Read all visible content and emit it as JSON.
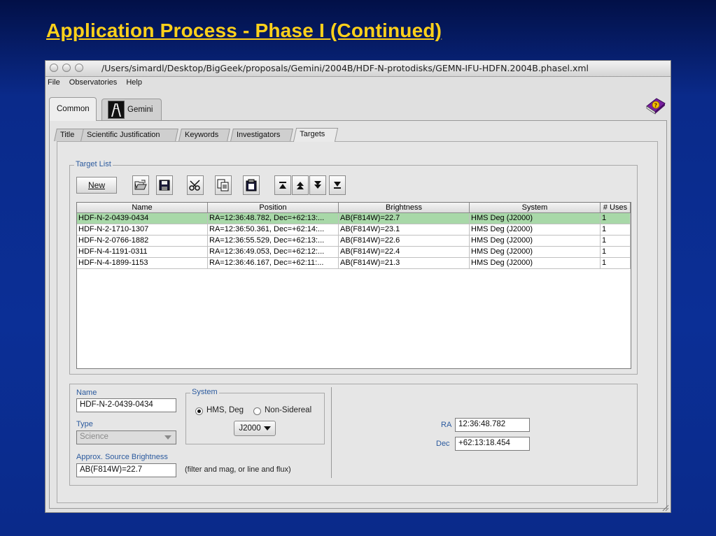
{
  "slide": {
    "title": "Application Process - Phase I (Continued)"
  },
  "window": {
    "path": "/Users/simardl/Desktop/BigGeek/proposals/Gemini/2004B/HDF-N-protodisks/GEMN-IFU-HDFN.2004B.phasel.xml",
    "menu": [
      "File",
      "Observatories",
      "Help"
    ]
  },
  "main_tabs": [
    {
      "label": "Common",
      "active": true
    },
    {
      "label": "Gemini",
      "active": false
    }
  ],
  "sub_tabs": [
    {
      "label": "Title",
      "active": false
    },
    {
      "label": "Scientific Justification",
      "active": false
    },
    {
      "label": "Keywords",
      "active": false
    },
    {
      "label": "Investigators",
      "active": false
    },
    {
      "label": "Targets",
      "active": true
    }
  ],
  "target_list": {
    "legend": "Target List",
    "new_button": "New",
    "columns": [
      "Name",
      "Position",
      "Brightness",
      "System",
      "# Uses"
    ],
    "rows": [
      [
        "HDF-N-2-0439-0434",
        "RA=12:36:48.782, Dec=+62:13:...",
        "AB(F814W)=22.7",
        "HMS Deg (J2000)",
        "1"
      ],
      [
        "HDF-N-2-1710-1307",
        "RA=12:36:50.361, Dec=+62:14:...",
        "AB(F814W)=23.1",
        "HMS Deg (J2000)",
        "1"
      ],
      [
        "HDF-N-2-0766-1882",
        "RA=12:36:55.529, Dec=+62:13:...",
        "AB(F814W)=22.6",
        "HMS Deg (J2000)",
        "1"
      ],
      [
        "HDF-N-4-1191-0311",
        "RA=12:36:49.053, Dec=+62:12:...",
        "AB(F814W)=22.4",
        "HMS Deg (J2000)",
        "1"
      ],
      [
        "HDF-N-4-1899-1153",
        "RA=12:36:46.167, Dec=+62:11:...",
        "AB(F814W)=21.3",
        "HMS Deg (J2000)",
        "1"
      ]
    ],
    "selected_row": 0
  },
  "details": {
    "name_label": "Name",
    "name_value": "HDF-N-2-0439-0434",
    "type_label": "Type",
    "type_value": "Science",
    "brightness_label": "Approx. Source Brightness",
    "brightness_value": "AB(F814W)=22.7",
    "brightness_hint": "(filter and mag, or line and flux)",
    "system_legend": "System",
    "radio_hms": "HMS, Deg",
    "radio_nonsidereal": "Non-Sidereal",
    "epoch": "J2000",
    "ra_label": "RA",
    "ra_value": "12:36:48.782",
    "dec_label": "Dec",
    "dec_value": "+62:13:18.454"
  },
  "colors": {
    "slide_bg": "#0a2a8a",
    "title": "#ffd11a",
    "selected_row": "#a8d8a8",
    "label_blue": "#2b5a9e"
  }
}
